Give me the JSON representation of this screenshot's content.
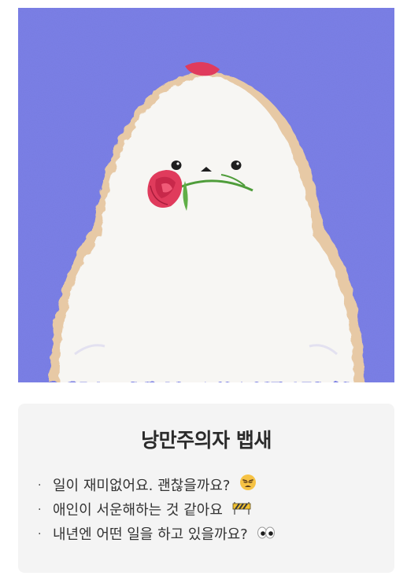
{
  "card": {
    "title": "낭만주의자 뱁새",
    "items": [
      {
        "bullet": "·",
        "text": "일이 재미없어요. 괜찮을까요?",
        "emoji_icon": "weary-face-icon"
      },
      {
        "bullet": "·",
        "text": "애인이 서운해하는 것 같아요",
        "emoji_icon": "construction-barrier-icon"
      },
      {
        "bullet": "·",
        "text": "내년엔 어떤 일을 하고 있을까요?",
        "emoji_icon": "eyes-icon"
      }
    ]
  },
  "colors": {
    "background_purple": "#7b7fe6",
    "bird_white": "#f7f6f3",
    "bird_shadow": "#e7c9a5",
    "rose": "#e03b5c",
    "stem": "#4f9d3a",
    "card_bg": "#f4f4f4"
  }
}
